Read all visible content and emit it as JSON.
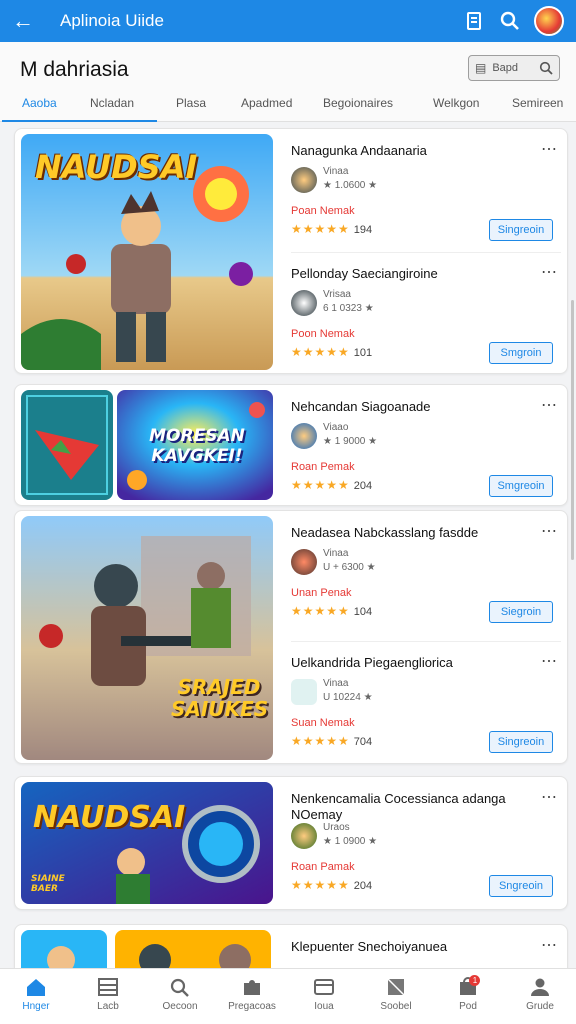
{
  "appbar": {
    "title": "Aplinoia Uiide",
    "back_icon": "arrow-back-icon",
    "icons": [
      "document-icon",
      "search-icon",
      "avatar"
    ]
  },
  "header": {
    "page_title": "M dahriasia",
    "search": {
      "label": "Bapd"
    },
    "tabs": [
      "Aaoba",
      "Ncladan",
      "Plasa",
      "Apadmed",
      "Begoionaires",
      "Welkgon",
      "Semireen"
    ],
    "active_tab": 0
  },
  "artwork": {
    "card1": "NAUDSAI",
    "card2": "MORESAN KAVGKEI!",
    "card3": "SRAJED SAIUKES",
    "card4": "NAUDSAI",
    "card4_sub": "SIAINE BAER"
  },
  "apps": [
    {
      "name": "Nanagunka Andaanaria",
      "dev": "Vinaa",
      "downloads": "★ 1.0600 ★",
      "status": "Poan Nemak",
      "stars": "★★★★★",
      "rating": "194",
      "button": "Singreoin"
    },
    {
      "name": "Pellonday Saeciangiroine",
      "dev": "Vrisaa",
      "downloads": "6 1 0323 ★",
      "status": "Poon Nemak",
      "stars": "★★★★★",
      "rating": "101",
      "button": "Smgroin"
    },
    {
      "name": "Nehcandan Siagoanade",
      "dev": "Viaao",
      "downloads": "★ 1 9000 ★",
      "status": "Roan Pemak",
      "stars": "★★★★★",
      "rating": "204",
      "button": "Smgreoin"
    },
    {
      "name": "Neadasea Nabckasslang fasdde",
      "dev": "Vinaa",
      "downloads": "U + 6300 ★",
      "status": "Unan Penak",
      "stars": "★★★★★",
      "rating": "104",
      "button": "Siegroin"
    },
    {
      "name": "Uelkandrida Piegaengliorica",
      "dev": "Vinaa",
      "downloads": "U 10224 ★",
      "status": "Suan Nemak",
      "stars": "★★★★★",
      "rating": "704",
      "button": "Singreoin"
    },
    {
      "name": "Nenkencamalia Cocessianca adanga NOemay",
      "dev": "Uraos",
      "downloads": "★ 1 0900 ★",
      "status": "Roan Pamak",
      "stars": "★★★★★",
      "rating": "204",
      "button": "Sngreoin"
    },
    {
      "name": "Klepuenter Snechoiyanuea",
      "dev": "",
      "downloads": "",
      "status": "",
      "stars": "",
      "rating": "",
      "button": ""
    }
  ],
  "bottom_nav": [
    {
      "label": "Hnger",
      "icon": "home-icon"
    },
    {
      "label": "Lacb",
      "icon": "grid-icon"
    },
    {
      "label": "Oecoon",
      "icon": "search-icon"
    },
    {
      "label": "Pregacoas",
      "icon": "puzzle-icon"
    },
    {
      "label": "Ioua",
      "icon": "card-icon"
    },
    {
      "label": "Soobel",
      "icon": "book-icon"
    },
    {
      "label": "Pod",
      "icon": "bag-icon",
      "badge": "1"
    },
    {
      "label": "Grude",
      "icon": "person-icon"
    }
  ],
  "colors": {
    "accent": "#1e88e5",
    "star": "#f9a825",
    "status": "#e53935"
  }
}
